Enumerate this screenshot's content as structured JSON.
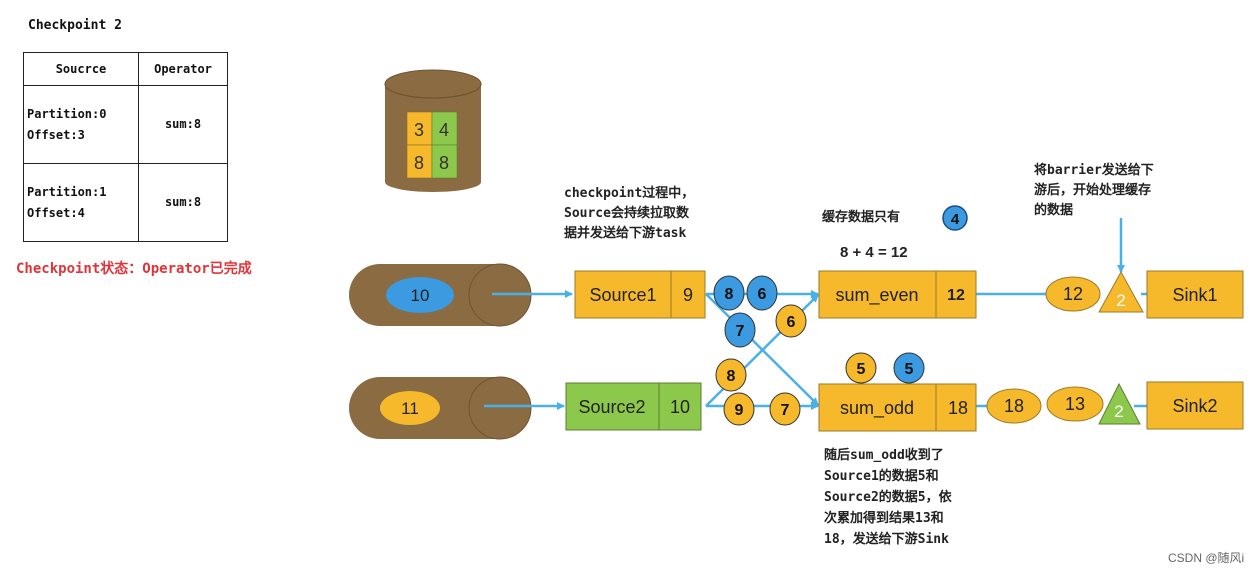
{
  "checkpoint": {
    "title": "Checkpoint 2",
    "table": {
      "headers": [
        "Soucrce",
        "Operator"
      ],
      "rows": [
        {
          "source_line1": "Partition:0",
          "source_line2": "Offset:3",
          "operator": "sum:8"
        },
        {
          "source_line1": "Partition:1",
          "source_line2": "Offset:4",
          "operator": "sum:8"
        }
      ]
    },
    "status": "Checkpoint状态：Operator已完成"
  },
  "state_store": {
    "cells": [
      [
        "3",
        "4"
      ],
      [
        "8",
        "8"
      ]
    ],
    "colors": [
      "#f6b92b",
      "#8cc84b"
    ]
  },
  "partitions": [
    {
      "label": "10",
      "color": "#3b9ae0"
    },
    {
      "label": "11",
      "color": "#f6b92b"
    }
  ],
  "sources": [
    {
      "name": "Source1",
      "value": "9",
      "color": "#f6b92b"
    },
    {
      "name": "Source2",
      "value": "10",
      "color": "#8cc84b"
    }
  ],
  "operators": [
    {
      "name": "sum_even",
      "value": "12"
    },
    {
      "name": "sum_odd",
      "value": "18"
    }
  ],
  "in_flight": {
    "source1_to_even": [
      "8",
      "6"
    ],
    "source1_to_odd": [
      "7"
    ],
    "source2_to_even": [
      "8",
      "6"
    ],
    "source2_to_odd": [
      "9",
      "7"
    ],
    "buffered_odd": [
      {
        "label": "5",
        "from": "source2"
      },
      {
        "label": "5",
        "from": "source1"
      }
    ]
  },
  "outputs": [
    {
      "records": [
        "12"
      ],
      "barrier": "2",
      "barrier_color": "#f6b92b",
      "sink": "Sink1"
    },
    {
      "records": [
        "18",
        "13"
      ],
      "barrier": "2",
      "barrier_color": "#8cc84b",
      "sink": "Sink2"
    }
  ],
  "notes": {
    "source_note": [
      "checkpoint过程中，",
      "Source会持续拉取数",
      "据并发送给下游task"
    ],
    "buffer_note": "缓存数据只有",
    "buffer_value": "4",
    "buffer_eq": "8 + 4 = 12",
    "barrier_note": [
      "将barrier发送给下",
      "游后，开始处理缓存",
      "的数据"
    ],
    "odd_note": [
      "随后sum_odd收到了",
      "Source1的数据5和",
      "Source2的数据5，依",
      "次累加得到结果13和",
      "18，发送给下游Sink"
    ]
  },
  "colors": {
    "blue": "#3b9ae0",
    "yellow": "#f6b92b",
    "green": "#8cc84b",
    "brown": "#8b6b42",
    "arrow": "#4ab0e8",
    "red": "#e0343a"
  },
  "watermark": "CSDN @随风i"
}
